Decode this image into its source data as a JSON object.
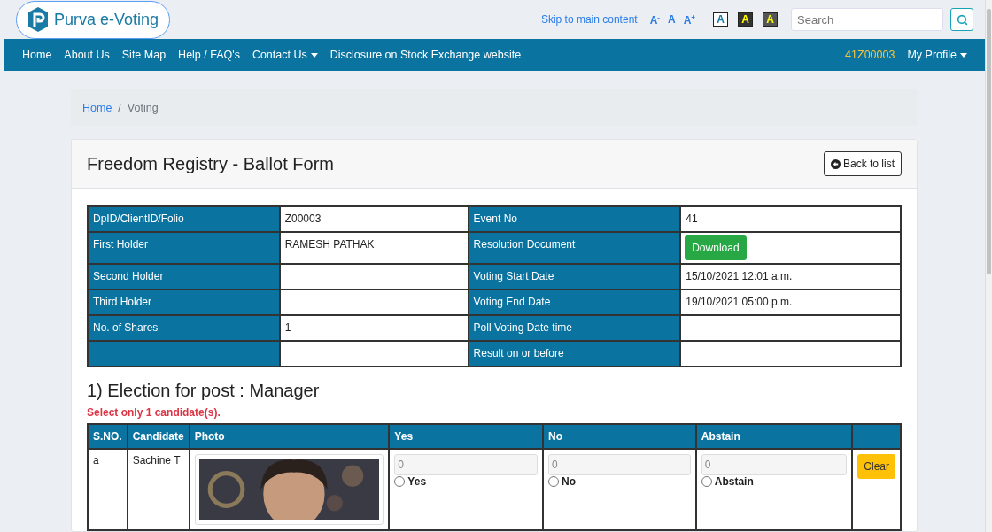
{
  "brand": {
    "name": "Purva e-Voting"
  },
  "top_links": {
    "skip": "Skip to main content",
    "font_sizes": [
      "A$^{-}$",
      "A",
      "A$^{+}$"
    ],
    "contrast": [
      {
        "label": "A",
        "kind": "light"
      },
      {
        "label": "A",
        "kind": "dark"
      },
      {
        "label": "A",
        "kind": "grey"
      }
    ]
  },
  "search": {
    "placeholder": "Search"
  },
  "nav": {
    "items": [
      {
        "label": "Home",
        "dropdown": false
      },
      {
        "label": "About Us",
        "dropdown": false
      },
      {
        "label": "Site Map",
        "dropdown": false
      },
      {
        "label": "Help / FAQ's",
        "dropdown": false
      },
      {
        "label": "Contact Us",
        "dropdown": true
      },
      {
        "label": "Disclosure on Stock Exchange website",
        "dropdown": false
      }
    ],
    "user_id": "41Z00003",
    "profile": {
      "label": "My Profile",
      "dropdown": true
    }
  },
  "breadcrumb": {
    "separator": "/",
    "items": [
      {
        "label": "Home",
        "link": true
      },
      {
        "label": "Voting",
        "link": false
      }
    ]
  },
  "card": {
    "title": "Freedom Registry - Ballot Form",
    "back_button": "Back to list"
  },
  "details": [
    {
      "cells": [
        {
          "label": "DpID/ClientID/Folio",
          "value": "Z00003"
        },
        {
          "label": "Event No",
          "value": "41"
        }
      ]
    },
    {
      "cells": [
        {
          "label": "First Holder",
          "value": "RAMESH PATHAK"
        },
        {
          "label": "Resolution Document",
          "value": "Download",
          "kind": "button"
        }
      ]
    },
    {
      "cells": [
        {
          "label": "Second Holder"
        },
        {
          "label": "Voting Start Date",
          "value": "15/10/2021 12:01 a.m."
        }
      ]
    },
    {
      "cells": [
        {
          "label": "Third Holder"
        },
        {
          "label": "Voting End Date",
          "value": "19/10/2021 05:00 p.m."
        }
      ]
    },
    {
      "cells": [
        {
          "label": "No. of Shares",
          "value": "1"
        },
        {
          "label": "Poll Voting Date time"
        }
      ]
    },
    {
      "cells": [
        {},
        {
          "label": "Result on or before"
        }
      ]
    }
  ],
  "election": {
    "heading": "1) Election for post : Manager",
    "note": "Select only 1 candidate(s).",
    "columns": [
      "S.NO.",
      "Candidate",
      "Photo",
      "Yes",
      "No",
      "Abstain"
    ],
    "rows": [
      {
        "sno": "a",
        "candidate": "Sachine T",
        "votes": [
          {
            "value": "0",
            "option": "Yes",
            "selected": false
          },
          {
            "value": "0",
            "option": "No",
            "selected": false
          },
          {
            "value": "0",
            "option": "Abstain",
            "selected": false
          }
        ],
        "clear": "Clear"
      }
    ]
  }
}
